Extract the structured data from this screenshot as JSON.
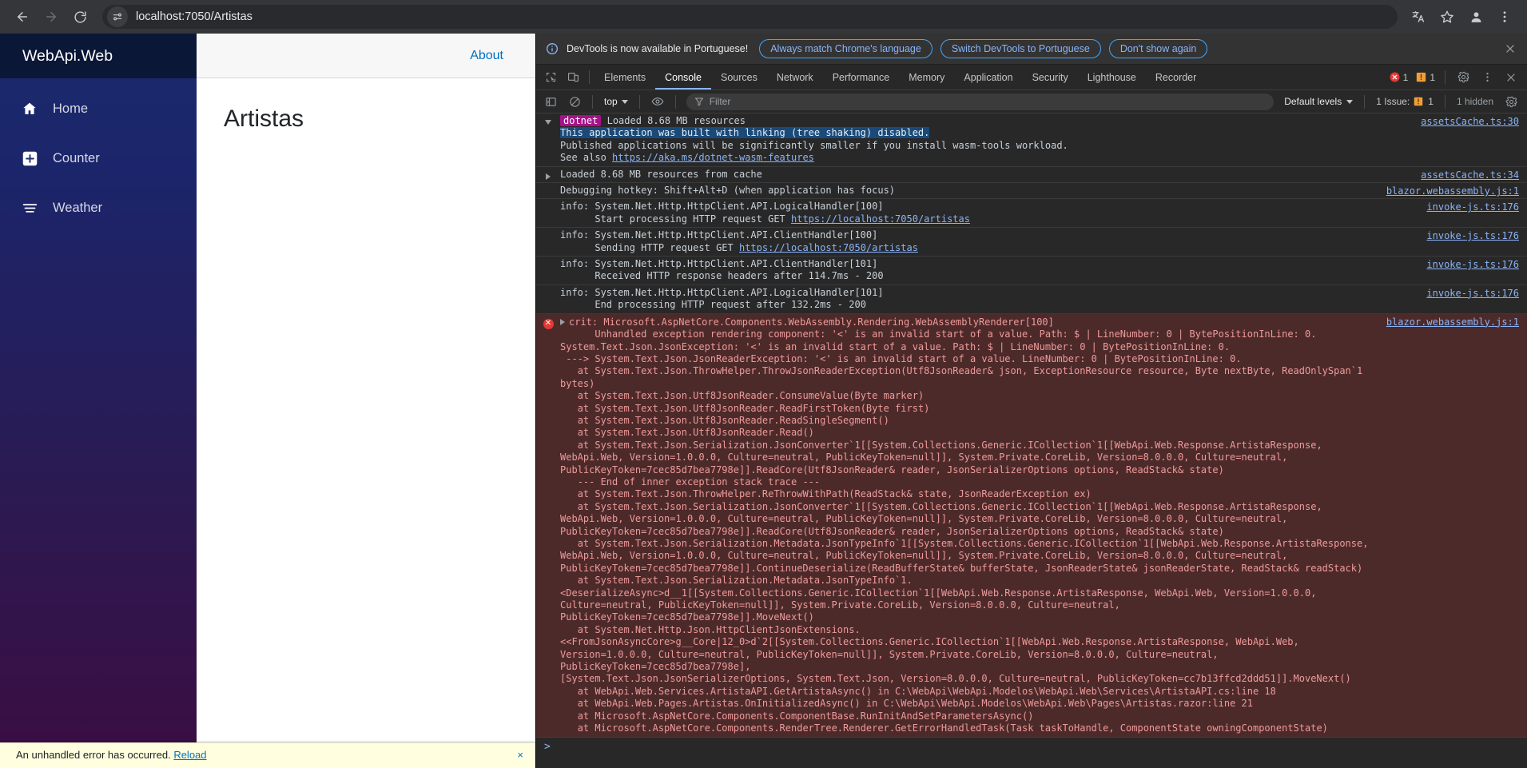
{
  "browser": {
    "url": "localhost:7050/Artistas",
    "back_label": "Back",
    "forward_label": "Forward",
    "reload_label": "Reload",
    "site_info_label": "View site information",
    "translate_label": "Translate this page",
    "bookmark_label": "Bookmark this tab",
    "profile_label": "Profile",
    "menu_label": "Customize and control Chrome"
  },
  "app": {
    "brand": "WebApi.Web",
    "nav_items": [
      {
        "label": "Home",
        "icon": "home-icon"
      },
      {
        "label": "Counter",
        "icon": "plus-icon"
      },
      {
        "label": "Weather",
        "icon": "list-icon"
      }
    ],
    "about_link": "About",
    "page_title": "Artistas",
    "error_ui": {
      "message": "An unhandled error has occurred.",
      "reload": "Reload",
      "dismiss": "×"
    }
  },
  "devtools": {
    "banner": {
      "text": "DevTools is now available in Portuguese!",
      "btn_match": "Always match Chrome's language",
      "btn_switch": "Switch DevTools to Portuguese",
      "btn_dismiss": "Don't show again",
      "close_label": "Close"
    },
    "tabs": [
      "Elements",
      "Console",
      "Sources",
      "Network",
      "Performance",
      "Memory",
      "Application",
      "Security",
      "Lighthouse",
      "Recorder"
    ],
    "active_tab": "Console",
    "inspect_label": "Inspect element",
    "device_label": "Toggle device toolbar",
    "error_count": "1",
    "warning_count": "1",
    "settings_label": "Settings",
    "more_label": "More options",
    "close_label": "Close DevTools",
    "toolbar": {
      "sidebar_label": "Show console sidebar",
      "clear_label": "Clear console",
      "context": "top",
      "eye_label": "Create live expression",
      "filter_placeholder": "Filter",
      "filter_value": "",
      "levels": "Default levels",
      "issues_label": "1 Issue:",
      "issues_count": "1",
      "hidden": "1 hidden",
      "settings_label": "Console settings"
    },
    "colors": {
      "accent": "#8ab4f8",
      "error_bg": "#4d2a2a",
      "error_text": "#ef9a9a",
      "dotnet_badge": "#a7118a",
      "selection": "#1a4a7a"
    },
    "messages": [
      {
        "id": "dotnet-group",
        "type": "group-open",
        "source": "assetsCache.ts:30",
        "badge": "dotnet",
        "title": "Loaded 8.68 MB resources",
        "lines": [
          {
            "text": "This application was built with linking (tree shaking) disabled.",
            "highlight": true
          },
          {
            "text": "Published applications will be significantly smaller if you install wasm-tools workload.",
            "highlight": false
          },
          {
            "text": "See also ",
            "link": "https://aka.ms/dotnet-wasm-features",
            "highlight": false
          }
        ]
      },
      {
        "id": "cache-group",
        "type": "group-closed",
        "source": "assetsCache.ts:34",
        "title": "Loaded 8.68 MB resources from cache",
        "lines": []
      },
      {
        "id": "hotkey",
        "type": "log",
        "source": "blazor.webassembly.js:1",
        "lines": [
          {
            "text": "Debugging hotkey: Shift+Alt+D (when application has focus)"
          }
        ]
      },
      {
        "id": "info-1",
        "type": "log",
        "source": "invoke-js.ts:176",
        "lines": [
          {
            "text": "info: System.Net.Http.HttpClient.API.LogicalHandler[100]"
          },
          {
            "text": "      Start processing HTTP request GET ",
            "link": "https://localhost:7050/artistas"
          }
        ]
      },
      {
        "id": "info-2",
        "type": "log",
        "source": "invoke-js.ts:176",
        "lines": [
          {
            "text": "info: System.Net.Http.HttpClient.API.ClientHandler[100]"
          },
          {
            "text": "      Sending HTTP request GET ",
            "link": "https://localhost:7050/artistas"
          }
        ]
      },
      {
        "id": "info-3",
        "type": "log",
        "source": "invoke-js.ts:176",
        "lines": [
          {
            "text": "info: System.Net.Http.HttpClient.API.ClientHandler[101]"
          },
          {
            "text": "      Received HTTP response headers after 114.7ms - 200"
          }
        ]
      },
      {
        "id": "info-4",
        "type": "log",
        "source": "invoke-js.ts:176",
        "lines": [
          {
            "text": "info: System.Net.Http.HttpClient.API.LogicalHandler[101]"
          },
          {
            "text": "      End processing HTTP request after 132.2ms - 200"
          }
        ]
      }
    ],
    "error_message": {
      "source": "blazor.webassembly.js:1",
      "header": "crit: Microsoft.AspNetCore.Components.WebAssembly.Rendering.WebAssemblyRenderer[100]",
      "lines": [
        "      Unhandled exception rendering component: '<' is an invalid start of a value. Path: $ | LineNumber: 0 | BytePositionInLine: 0.",
        "System.Text.Json.JsonException: '<' is an invalid start of a value. Path: $ | LineNumber: 0 | BytePositionInLine: 0.",
        " ---> System.Text.Json.JsonReaderException: '<' is an invalid start of a value. LineNumber: 0 | BytePositionInLine: 0.",
        "   at System.Text.Json.ThrowHelper.ThrowJsonReaderException(Utf8JsonReader& json, ExceptionResource resource, Byte nextByte, ReadOnlySpan`1 bytes)",
        "   at System.Text.Json.Utf8JsonReader.ConsumeValue(Byte marker)",
        "   at System.Text.Json.Utf8JsonReader.ReadFirstToken(Byte first)",
        "   at System.Text.Json.Utf8JsonReader.ReadSingleSegment()",
        "   at System.Text.Json.Utf8JsonReader.Read()",
        "   at System.Text.Json.Serialization.JsonConverter`1[[System.Collections.Generic.ICollection`1[[WebApi.Web.Response.ArtistaResponse, WebApi.Web, Version=1.0.0.0, Culture=neutral, PublicKeyToken=null]], System.Private.CoreLib, Version=8.0.0.0, Culture=neutral, PublicKeyToken=7cec85d7bea7798e]].ReadCore(Utf8JsonReader& reader, JsonSerializerOptions options, ReadStack& state)",
        "   --- End of inner exception stack trace ---",
        "   at System.Text.Json.ThrowHelper.ReThrowWithPath(ReadStack& state, JsonReaderException ex)",
        "   at System.Text.Json.Serialization.JsonConverter`1[[System.Collections.Generic.ICollection`1[[WebApi.Web.Response.ArtistaResponse, WebApi.Web, Version=1.0.0.0, Culture=neutral, PublicKeyToken=null]], System.Private.CoreLib, Version=8.0.0.0, Culture=neutral, PublicKeyToken=7cec85d7bea7798e]].ReadCore(Utf8JsonReader& reader, JsonSerializerOptions options, ReadStack& state)",
        "   at System.Text.Json.Serialization.Metadata.JsonTypeInfo`1[[System.Collections.Generic.ICollection`1[[WebApi.Web.Response.ArtistaResponse, WebApi.Web, Version=1.0.0.0, Culture=neutral, PublicKeyToken=null]], System.Private.CoreLib, Version=8.0.0.0, Culture=neutral, PublicKeyToken=7cec85d7bea7798e]].ContinueDeserialize(ReadBufferState& bufferState, JsonReaderState& jsonReaderState, ReadStack& readStack)",
        "   at System.Text.Json.Serialization.Metadata.JsonTypeInfo`1.<DeserializeAsync>d__1[[System.Collections.Generic.ICollection`1[[WebApi.Web.Response.ArtistaResponse, WebApi.Web, Version=1.0.0.0, Culture=neutral, PublicKeyToken=null]], System.Private.CoreLib, Version=8.0.0.0, Culture=neutral, PublicKeyToken=7cec85d7bea7798e]].MoveNext()",
        "   at System.Net.Http.Json.HttpClientJsonExtensions.<<FromJsonAsyncCore>g__Core|12_0>d`2[[System.Collections.Generic.ICollection`1[[WebApi.Web.Response.ArtistaResponse, WebApi.Web, Version=1.0.0.0, Culture=neutral, PublicKeyToken=null]], System.Private.CoreLib, Version=8.0.0.0, Culture=neutral, PublicKeyToken=7cec85d7bea7798e],",
        "[System.Text.Json.JsonSerializerOptions, System.Text.Json, Version=8.0.0.0, Culture=neutral, PublicKeyToken=cc7b13ffcd2ddd51]].MoveNext()",
        "   at WebApi.Web.Services.ArtistaAPI.GetArtistaAsync() in C:\\WebApi\\WebApi.Modelos\\WebApi.Web\\Services\\ArtistaAPI.cs:line 18",
        "   at WebApi.Web.Pages.Artistas.OnInitializedAsync() in C:\\WebApi\\WebApi.Modelos\\WebApi.Web\\Pages\\Artistas.razor:line 21",
        "   at Microsoft.AspNetCore.Components.ComponentBase.RunInitAndSetParametersAsync()",
        "   at Microsoft.AspNetCore.Components.RenderTree.Renderer.GetErrorHandledTask(Task taskToHandle, ComponentState owningComponentState)"
      ]
    },
    "prompt": ">"
  }
}
